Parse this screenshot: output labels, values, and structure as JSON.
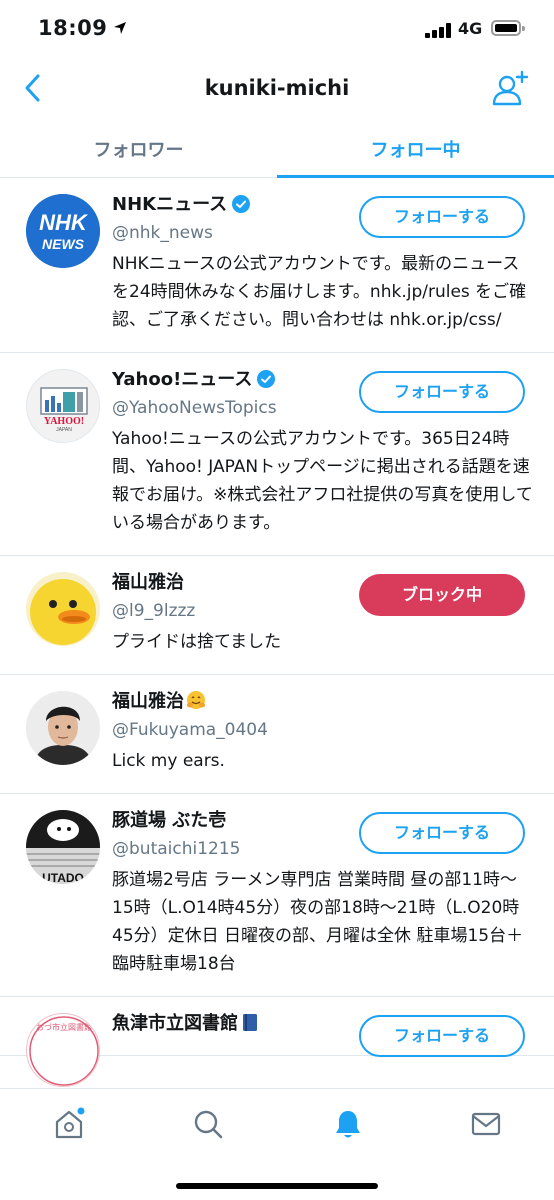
{
  "status_bar": {
    "time": "18:09",
    "network": "4G"
  },
  "header": {
    "title": "kuniki-michi"
  },
  "tabs": [
    {
      "label": "フォロワー",
      "active": false
    },
    {
      "label": "フォロー中",
      "active": true
    }
  ],
  "users": [
    {
      "name": "NHKニュース",
      "verified": true,
      "handle": "@nhk_news",
      "bio": "NHKニュースの公式アカウントです。最新のニュースを24時間休みなくお届けします。nhk.jp/rules をご確認、ご了承ください。問い合わせは nhk.or.jp/css/",
      "button": "フォローする",
      "avatar_text": [
        "NHK",
        "NEWS"
      ]
    },
    {
      "name": "Yahoo!ニュース",
      "verified": true,
      "handle": "@YahooNewsTopics",
      "bio": "Yahoo!ニュースの公式アカウントです。365日24時間、Yahoo! JAPANトップページに掲出される話題を速報でお届け。※株式会社アフロ社提供の写真を使用している場合があります。",
      "button": "フォローする",
      "avatar_text": [
        "YAHOO!",
        "JAPAN"
      ]
    },
    {
      "name": "福山雅治",
      "verified": false,
      "handle": "@l9_9lzzz",
      "bio": "プライドは捨てました",
      "button": "ブロック中"
    },
    {
      "name": "福山雅治",
      "verified": false,
      "handle": "@Fukuyama_0404",
      "bio": "Lick my ears.",
      "button": ""
    },
    {
      "name": "豚道場 ぶた壱",
      "verified": false,
      "handle": "@butaichi1215",
      "bio": "豚道場2号店 ラーメン専門店 営業時間 昼の部11時〜15時（L.O14時45分）夜の部18時〜21時（L.O20時45分）定休日 日曜夜の部、月曜は全休 駐車場15台＋臨時駐車場18台",
      "button": "フォローする",
      "avatar_text": [
        "UTADO"
      ]
    },
    {
      "name": "魚津市立図書館",
      "verified": false,
      "handle": "",
      "bio": "",
      "button": "フォローする",
      "avatar_text": [
        "おづ市立図書館"
      ]
    }
  ],
  "colors": {
    "accent": "#1da1f2",
    "blocked": "#d93c5b",
    "secondary_text": "#657786",
    "divider": "#e1e8ed"
  },
  "tab_bar": [
    "home-icon",
    "search-icon",
    "notifications-icon",
    "messages-icon"
  ]
}
